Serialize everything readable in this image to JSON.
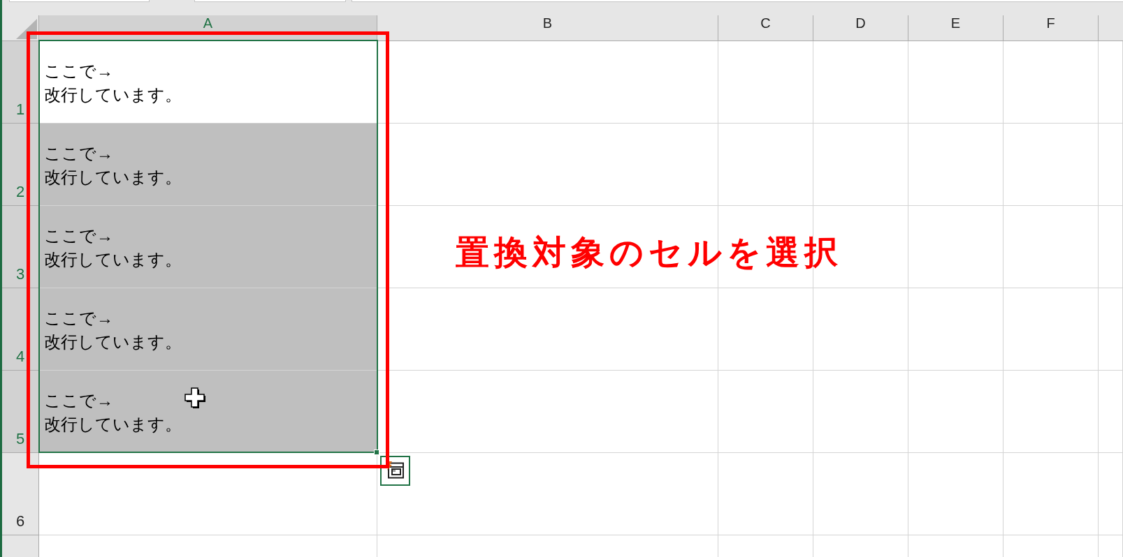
{
  "sheet": {
    "columns": [
      {
        "label": "A",
        "selected": true
      },
      {
        "label": "B",
        "selected": false
      },
      {
        "label": "C",
        "selected": false
      },
      {
        "label": "D",
        "selected": false
      },
      {
        "label": "E",
        "selected": false
      },
      {
        "label": "F",
        "selected": false
      }
    ],
    "rows": [
      {
        "label": "1",
        "selected": true,
        "cells": [
          {
            "text": "ここで→\n改行しています。",
            "selected": true,
            "active": true
          }
        ]
      },
      {
        "label": "2",
        "selected": true,
        "cells": [
          {
            "text": "ここで→\n改行しています。",
            "selected": true,
            "active": false
          }
        ]
      },
      {
        "label": "3",
        "selected": true,
        "cells": [
          {
            "text": "ここで→\n改行しています。",
            "selected": true,
            "active": false
          }
        ]
      },
      {
        "label": "4",
        "selected": true,
        "cells": [
          {
            "text": "ここで→\n改行しています。",
            "selected": true,
            "active": false
          }
        ]
      },
      {
        "label": "5",
        "selected": true,
        "cells": [
          {
            "text": "ここで→\n改行しています。",
            "selected": true,
            "active": false
          }
        ]
      },
      {
        "label": "6",
        "selected": false
      }
    ]
  },
  "annotation": {
    "text": "置換対象のセルを選択"
  }
}
